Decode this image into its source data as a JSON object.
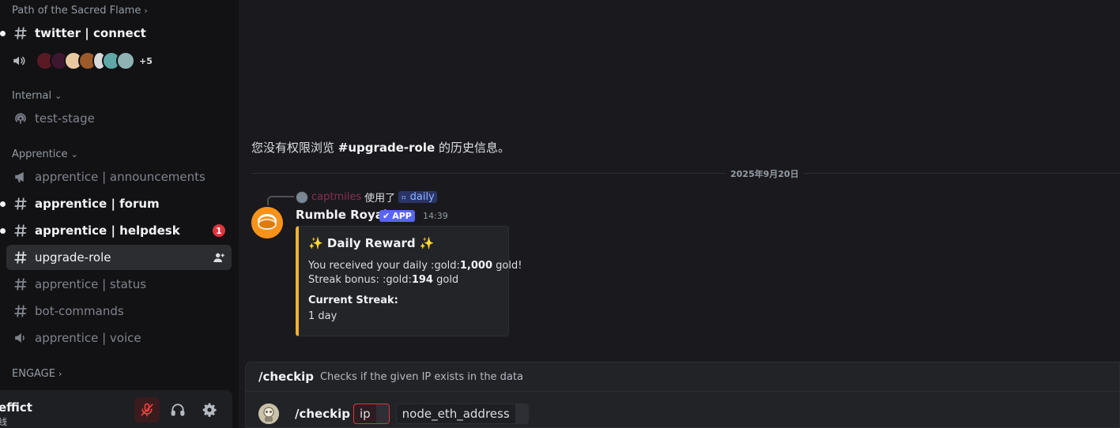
{
  "sidebar": {
    "categories": [
      {
        "label": "Path of the Sacred Flame",
        "chevron": "›"
      },
      {
        "label": "Internal",
        "chevron": "⌄"
      },
      {
        "label": "Apprentice",
        "chevron": "⌄"
      },
      {
        "label": "ENGAGE",
        "chevron": "›"
      }
    ],
    "channels": [
      {
        "name": "twitter | connect",
        "icon": "hash-icon",
        "state": "unread"
      },
      {
        "name": "test-stage",
        "icon": "stage-icon",
        "state": "read"
      },
      {
        "name": "apprentice | announcements",
        "icon": "announcement-icon",
        "state": "read"
      },
      {
        "name": "apprentice | forum",
        "icon": "hash-icon",
        "state": "unread"
      },
      {
        "name": "apprentice | helpdesk",
        "icon": "hash-icon",
        "state": "unread",
        "badge": "1"
      },
      {
        "name": "upgrade-role",
        "icon": "hash-icon",
        "state": "active"
      },
      {
        "name": "apprentice | status",
        "icon": "hash-icon",
        "state": "read"
      },
      {
        "name": "bot-commands",
        "icon": "hash-icon",
        "state": "read"
      },
      {
        "name": "apprentice | voice",
        "icon": "voice-announcement-icon",
        "state": "read"
      }
    ],
    "voice_overflow": "+5"
  },
  "user_panel": {
    "name": "effict",
    "status": "线"
  },
  "chat": {
    "no_access_prefix": "您没有权限浏览 ",
    "no_access_channel": "#upgrade-role",
    "no_access_suffix": " 的历史信息。",
    "date_divider": "2025年9月20日",
    "reply": {
      "user": "captmiles",
      "used_text": "使用了",
      "command": "daily"
    },
    "message": {
      "author": "Rumble Royale",
      "app_tag": "APP",
      "time": "14:39",
      "embed": {
        "title": "✨ Daily Reward ✨",
        "line1_prefix": "You received your daily :gold:",
        "line1_amount": "1,000",
        "line1_suffix": " gold!",
        "line2_prefix": "Streak bonus: :gold:",
        "line2_amount": "194",
        "line2_suffix": " gold",
        "field_name": "Current Streak:",
        "field_value": "1 day"
      }
    }
  },
  "command_bar": {
    "name": "/checkip",
    "description": "Checks if the given IP exists in the data",
    "slash": "/checkip",
    "options": [
      {
        "label": "ip",
        "state": "error"
      },
      {
        "label": "node_eth_address",
        "state": "normal"
      }
    ]
  },
  "colors": {
    "embed_accent": "#f0b232",
    "app_tag": "#5865f2",
    "badge": "#da373c",
    "error": "#da373c"
  }
}
